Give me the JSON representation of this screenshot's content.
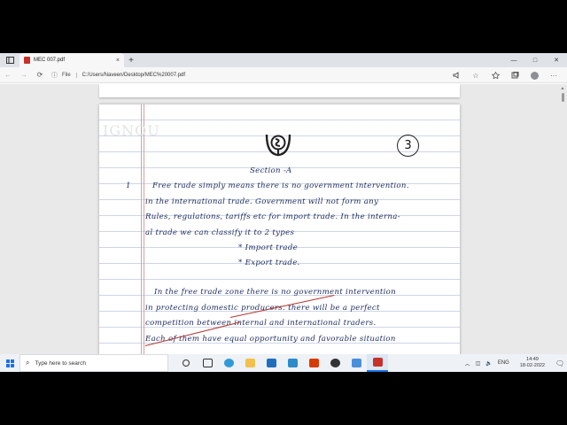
{
  "browser": {
    "tab_title": "MEC 007.pdf",
    "tab_close": "×",
    "new_tab": "+",
    "win_min": "—",
    "win_max": "□",
    "win_close": "✕",
    "url_label": "File",
    "url": "C:/Users/Naveen/Desktop/MEC%20007.pdf",
    "back": "←",
    "forward": "→",
    "refresh": "⟳",
    "info": "ⓘ"
  },
  "document": {
    "stamp": "IGNOU",
    "page_number": "3",
    "lines": [
      "Section -A",
      "1",
      "Free trade simply means there is no government intervention.",
      "in the international trade. Government will not form any",
      "Rules, regulations, tariffs etc for import trade. In the interna-",
      "al trade we can classify it to 2 types",
      "* Import trade",
      "* Export trade.",
      "In the free trade zone there is no government intervention",
      "in protecting domestic producers. there will be a perfect",
      "competition between internal and international traders.",
      "Each of them have equal opportunity and favorable situation"
    ]
  },
  "taskbar": {
    "search_placeholder": "Type here to search",
    "language": "ENG",
    "time": "14:49",
    "date": "18-02-2022"
  },
  "colors": {
    "ink": "#1b2a5e",
    "accent": "#1a73e8",
    "pdf_red": "#c8302b"
  }
}
